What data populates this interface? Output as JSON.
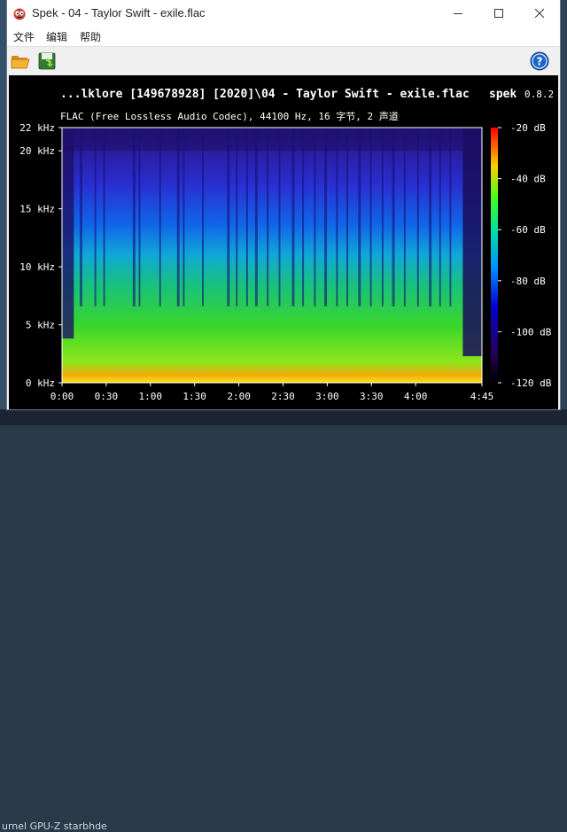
{
  "window": {
    "title": "Spek - 04 - Taylor Swift - exile.flac"
  },
  "menu": {
    "file": "文件",
    "edit": "编辑",
    "help": "帮助"
  },
  "toolbar": {
    "open_icon": "folder-open-icon",
    "save_icon": "save-icon",
    "help_icon": "help-icon"
  },
  "spectrogram": {
    "title": "...lklore [149678928] [2020]\\04 - Taylor Swift - exile.flac",
    "app_name": "spek",
    "version": "0.8.2",
    "subtitle": "FLAC (Free Lossless Audio Codec), 44100 Hz, 16 字节, 2 声道"
  },
  "desktop": {
    "taskbar_fragment": "urnel   GPU-Z   starbhde"
  },
  "colors": {
    "background": "#000000",
    "text": "#ffffff"
  },
  "chart_data": {
    "type": "heatmap",
    "x": {
      "range": [
        0,
        285
      ],
      "unit": "s",
      "ticks": [
        0,
        30,
        60,
        90,
        120,
        150,
        180,
        210,
        240,
        285
      ],
      "tick_labels": [
        "0:00",
        "0:30",
        "1:00",
        "1:30",
        "2:00",
        "2:30",
        "3:00",
        "3:30",
        "4:00",
        "4:45"
      ]
    },
    "y": {
      "range": [
        0,
        22
      ],
      "unit": "kHz",
      "ticks": [
        0,
        5,
        10,
        15,
        20,
        22
      ],
      "tick_labels": [
        "0 kHz",
        "5 kHz",
        "10 kHz",
        "15 kHz",
        "20 kHz",
        "22 kHz"
      ]
    },
    "colorbar": {
      "range": [
        -120,
        -20
      ],
      "unit": "dB",
      "ticks": [
        -20,
        -40,
        -60,
        -80,
        -100,
        -120
      ],
      "tick_labels": [
        "-20 dB",
        "-40 dB",
        "-60 dB",
        "-80 dB",
        "-100 dB",
        "-120 dB"
      ]
    },
    "grid": false,
    "legend": "right"
  }
}
